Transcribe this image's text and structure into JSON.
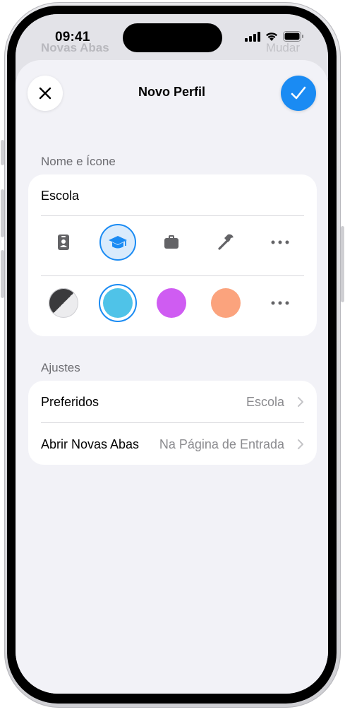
{
  "background": {
    "title": "Novas Abas",
    "right": "Mudar"
  },
  "status_bar": {
    "time": "09:41",
    "icons": [
      "cellular-signal-icon",
      "wifi-icon",
      "battery-icon"
    ]
  },
  "sheet": {
    "title": "Novo Perfil",
    "close_icon": "close-icon",
    "done_icon": "checkmark-icon"
  },
  "name_section": {
    "header": "Nome e Ícone",
    "name_value": "Escola",
    "icons": [
      {
        "name": "id-badge-icon",
        "selected": false
      },
      {
        "name": "graduation-cap-icon",
        "selected": true
      },
      {
        "name": "briefcase-icon",
        "selected": false
      },
      {
        "name": "hammer-icon",
        "selected": false
      },
      {
        "name": "more-icon",
        "selected": false
      }
    ],
    "colors": [
      {
        "name": "gray-split",
        "hex": "#3a3a3c",
        "selected": false
      },
      {
        "name": "cyan",
        "hex": "#4fc3e8",
        "selected": true
      },
      {
        "name": "purple",
        "hex": "#cf5cf2",
        "selected": false
      },
      {
        "name": "orange",
        "hex": "#fba37d",
        "selected": false
      },
      {
        "name": "more",
        "hex": "",
        "selected": false
      }
    ]
  },
  "settings_section": {
    "header": "Ajustes",
    "rows": [
      {
        "label": "Preferidos",
        "value": "Escola"
      },
      {
        "label": "Abrir Novas Abas",
        "value": "Na Página de Entrada"
      }
    ]
  },
  "colors": {
    "accent": "#1a8bf3",
    "background": "#f2f2f7",
    "secondary_text": "#8a8a8e"
  }
}
